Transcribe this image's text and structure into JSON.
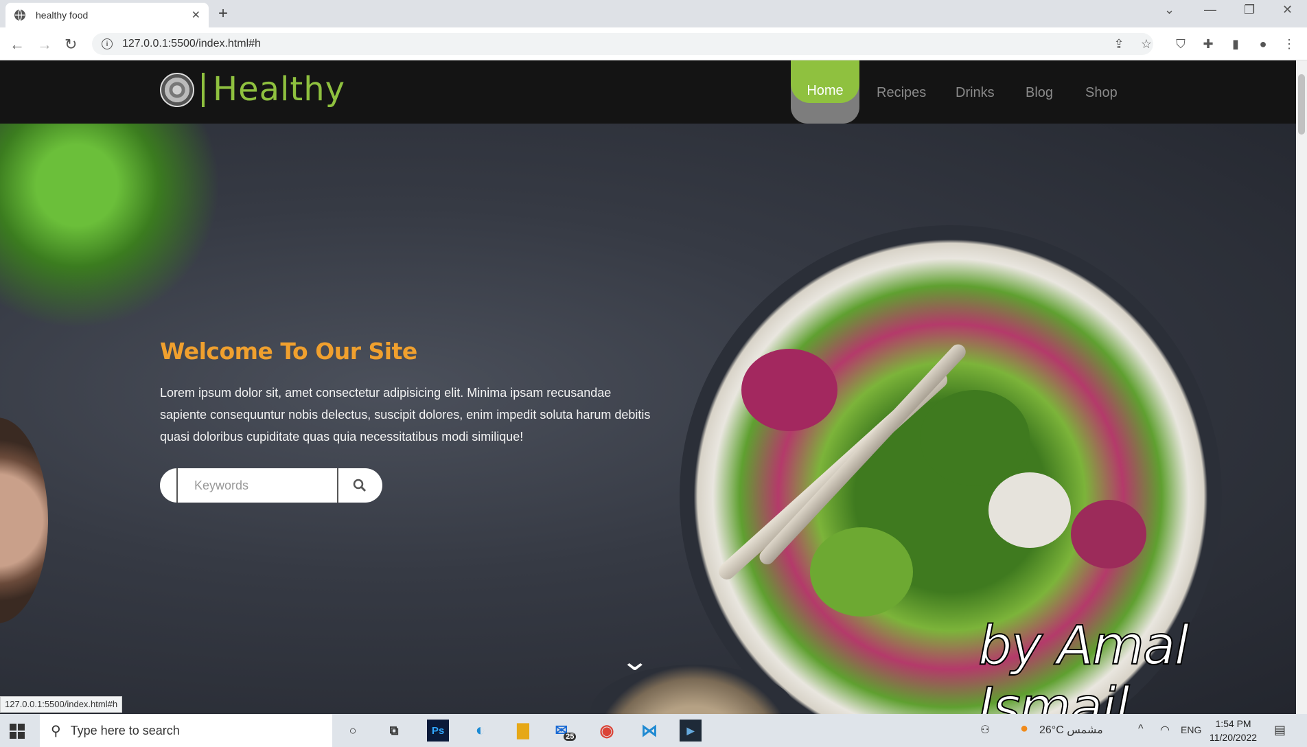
{
  "browser": {
    "tab_title": "healthy food",
    "url": "127.0.0.1:5500/index.html#h",
    "status_url": "127.0.0.1:5500/index.html#h"
  },
  "site": {
    "logo_text": "Healthy",
    "nav": [
      "Home",
      "Recipes",
      "Drinks",
      "Blog",
      "Shop"
    ],
    "hero_title": "Welcome To Our Site",
    "hero_text": "Lorem ipsum dolor sit, amet consectetur adipisicing elit. Minima ipsam recusandae sapiente consequuntur nobis delectus, suscipit dolores, enim impedit soluta harum debitis quasi doloribus cupiditate quas quia necessitatibus modi similique!",
    "search_placeholder": "Keywords",
    "watermark": "by Amal Ismail",
    "colors": {
      "accent_green": "#8fc13f",
      "title_orange": "#f0a02e",
      "header_bg": "#141414"
    }
  },
  "taskbar": {
    "search_placeholder": "Type here to search",
    "mail_badge": "25",
    "weather": "26°C  مشمس",
    "lang": "ENG",
    "time": "1:54 PM",
    "date": "11/20/2022"
  }
}
